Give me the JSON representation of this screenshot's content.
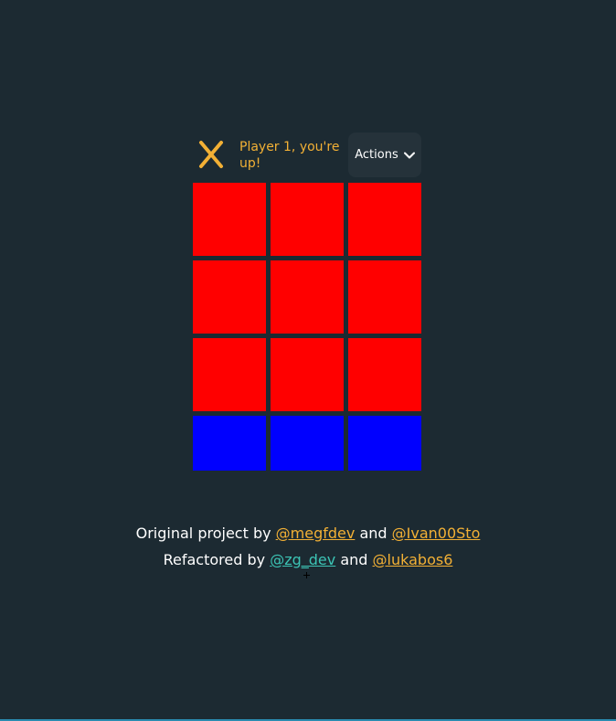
{
  "header": {
    "turn_icon": "x-icon",
    "turn_text": "Player 1, you're up!",
    "actions_label": "Actions",
    "actions_icon": "chevron-down-icon"
  },
  "board": {
    "rows": 4,
    "columns": 3,
    "cell_colors": [
      "#ff0000",
      "#ff0000",
      "#ff0000",
      "#ff0000",
      "#ff0000",
      "#ff0000",
      "#ff0000",
      "#ff0000",
      "#ff0000",
      "#0000ff",
      "#0000ff",
      "#0000ff"
    ]
  },
  "footer": {
    "line1_prefix": "Original project by",
    "line1_link1": "@megfdev",
    "line1_and": "and",
    "line1_link2": "@Ivan00Sto",
    "line2_prefix": "Refactored by",
    "line2_link1": "@zg_dev",
    "line2_and": "and",
    "line2_link2": "@lukabos6"
  },
  "colors": {
    "background": "#1c2a32",
    "accent": "#f2b035",
    "teal_link": "#3cc4b5",
    "button_bg": "#25323a",
    "cell_red": "#ff0000",
    "cell_blue": "#0000ff"
  }
}
